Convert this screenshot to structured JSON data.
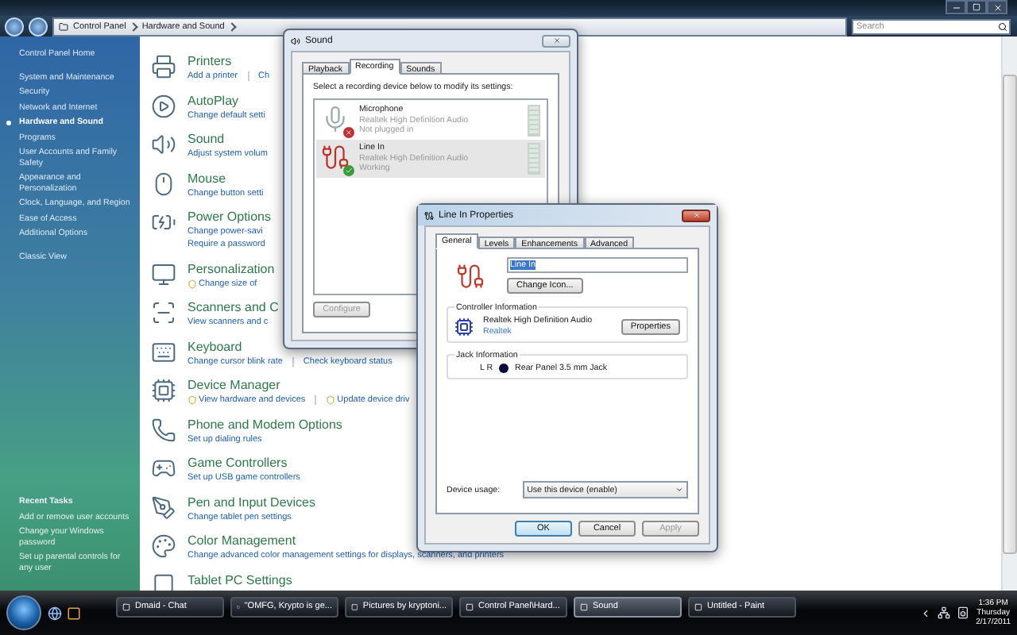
{
  "window": {
    "breadcrumb": [
      "Control Panel",
      "Hardware and Sound"
    ],
    "search": {
      "placeholder": "Search"
    }
  },
  "sidebar": {
    "items": [
      {
        "label": "Control Panel Home",
        "selected": false
      },
      {
        "label": "System and Maintenance",
        "selected": false
      },
      {
        "label": "Security",
        "selected": false
      },
      {
        "label": "Network and Internet",
        "selected": false
      },
      {
        "label": "Hardware and Sound",
        "selected": true
      },
      {
        "label": "Programs",
        "selected": false
      },
      {
        "label": "User Accounts and Family Safety",
        "selected": false
      },
      {
        "label": "Appearance and Personalization",
        "selected": false
      },
      {
        "label": "Clock, Language, and Region",
        "selected": false
      },
      {
        "label": "Ease of Access",
        "selected": false
      },
      {
        "label": "Additional Options",
        "selected": false
      },
      {
        "label": "Classic View",
        "selected": false
      }
    ],
    "recent_tasks": {
      "title": "Recent Tasks",
      "items": [
        "Add or remove user accounts",
        "Change your Windows password",
        "Set up parental controls for any user"
      ]
    }
  },
  "categories": [
    {
      "kind": "printer",
      "title": "Printers",
      "link_rows": [
        [
          {
            "text": "Add a printer",
            "shield": false
          },
          {
            "text": "Ch",
            "shield": false
          }
        ]
      ]
    },
    {
      "kind": "autoplay",
      "title": "AutoPlay",
      "link_rows": [
        [
          {
            "text": "Change default setti",
            "shield": false
          }
        ]
      ]
    },
    {
      "kind": "sound",
      "title": "Sound",
      "link_rows": [
        [
          {
            "text": "Adjust system volum",
            "shield": false
          }
        ]
      ]
    },
    {
      "kind": "mouse",
      "title": "Mouse",
      "link_rows": [
        [
          {
            "text": "Change button setti",
            "shield": false
          }
        ]
      ]
    },
    {
      "kind": "power",
      "title": "Power Options",
      "link_rows": [
        [
          {
            "text": "Change power-savi",
            "shield": false
          }
        ],
        [
          {
            "text": "Require a password",
            "shield": false
          }
        ]
      ]
    },
    {
      "kind": "personalization",
      "title": "Personalization",
      "link_rows": [
        [
          {
            "text": "Change size of",
            "shield": true
          }
        ]
      ]
    },
    {
      "kind": "scanner",
      "title": "Scanners and C",
      "link_rows": [
        [
          {
            "text": "View scanners and c",
            "shield": false
          }
        ]
      ]
    },
    {
      "kind": "keyboard",
      "title": "Keyboard",
      "link_rows": [
        [
          {
            "text": "Change cursor blink rate",
            "shield": false
          },
          {
            "text": "Check keyboard status",
            "shield": false
          }
        ]
      ]
    },
    {
      "kind": "device_manager",
      "title": "Device Manager",
      "link_rows": [
        [
          {
            "text": "View hardware and devices",
            "shield": true
          },
          {
            "text": "Update device driv",
            "shield": true
          }
        ]
      ]
    },
    {
      "kind": "phone",
      "title": "Phone and Modem Options",
      "link_rows": [
        [
          {
            "text": "Set up dialing rules",
            "shield": false
          }
        ]
      ]
    },
    {
      "kind": "game",
      "title": "Game Controllers",
      "link_rows": [
        [
          {
            "text": "Set up USB game controllers",
            "shield": false
          }
        ]
      ]
    },
    {
      "kind": "pen",
      "title": "Pen and Input Devices",
      "link_rows": [
        [
          {
            "text": "Change tablet pen settings",
            "shield": false
          }
        ]
      ]
    },
    {
      "kind": "color",
      "title": "Color Management",
      "link_rows": [
        [
          {
            "text": "Change advanced color management settings for displays, scanners, and printers",
            "shield": false
          }
        ]
      ]
    },
    {
      "kind": "tablet",
      "title": "Tablet PC Settings"
    }
  ],
  "sound_dialog": {
    "title": "Sound",
    "tabs": [
      {
        "label": "Playback",
        "selected": false
      },
      {
        "label": "Recording",
        "selected": true
      },
      {
        "label": "Sounds",
        "selected": false
      }
    ],
    "instruction": "Select a recording device below to modify its settings:",
    "devices": [
      {
        "kind": "microphone",
        "name": "Microphone",
        "driver": "Realtek High Definition Audio",
        "status": "Not plugged in",
        "plugged": false,
        "selected": false
      },
      {
        "kind": "line",
        "name": "Line In",
        "driver": "Realtek High Definition Audio",
        "status": "Working",
        "plugged": true,
        "selected": true
      }
    ],
    "configure": {
      "label": "Configure",
      "disabled": true
    }
  },
  "properties_dialog": {
    "title": "Line In Properties",
    "tabs": [
      {
        "label": "General",
        "selected": true
      },
      {
        "label": "Levels",
        "selected": false
      },
      {
        "label": "Enhancements",
        "selected": false
      },
      {
        "label": "Advanced",
        "selected": false
      }
    ],
    "name": {
      "value": "Line In",
      "highlighted": true
    },
    "change_icon": "Change Icon...",
    "controller": {
      "title": "Controller Information",
      "name": "Realtek High Definition Audio",
      "link": "Realtek",
      "button": "Properties"
    },
    "jack": {
      "title": "Jack Information",
      "channels": "L R",
      "color": "#0a0a3a",
      "label": "Rear Panel 3.5 mm Jack"
    },
    "device_usage": {
      "label": "Device usage:",
      "value": "Use this device (enable)"
    },
    "buttons": [
      {
        "label": "OK",
        "disabled": false,
        "default": true
      },
      {
        "label": "Cancel",
        "disabled": false,
        "default": false
      },
      {
        "label": "Apply",
        "disabled": true,
        "default": false
      }
    ]
  },
  "taskbar": {
    "tasks": [
      {
        "label": "Dmaid - Chat",
        "selected": false
      },
      {
        "label": "\"OMFG, Krypto is ge...",
        "selected": false
      },
      {
        "label": "Pictures by kryptoni...",
        "selected": false
      },
      {
        "label": "Control Panel\\Hard...",
        "selected": false
      },
      {
        "label": "Sound",
        "selected": true
      },
      {
        "label": "Untitled - Paint",
        "selected": false
      }
    ],
    "clock": {
      "time": "1:36 PM",
      "day": "Thursday",
      "date": "2/17/2011"
    }
  }
}
